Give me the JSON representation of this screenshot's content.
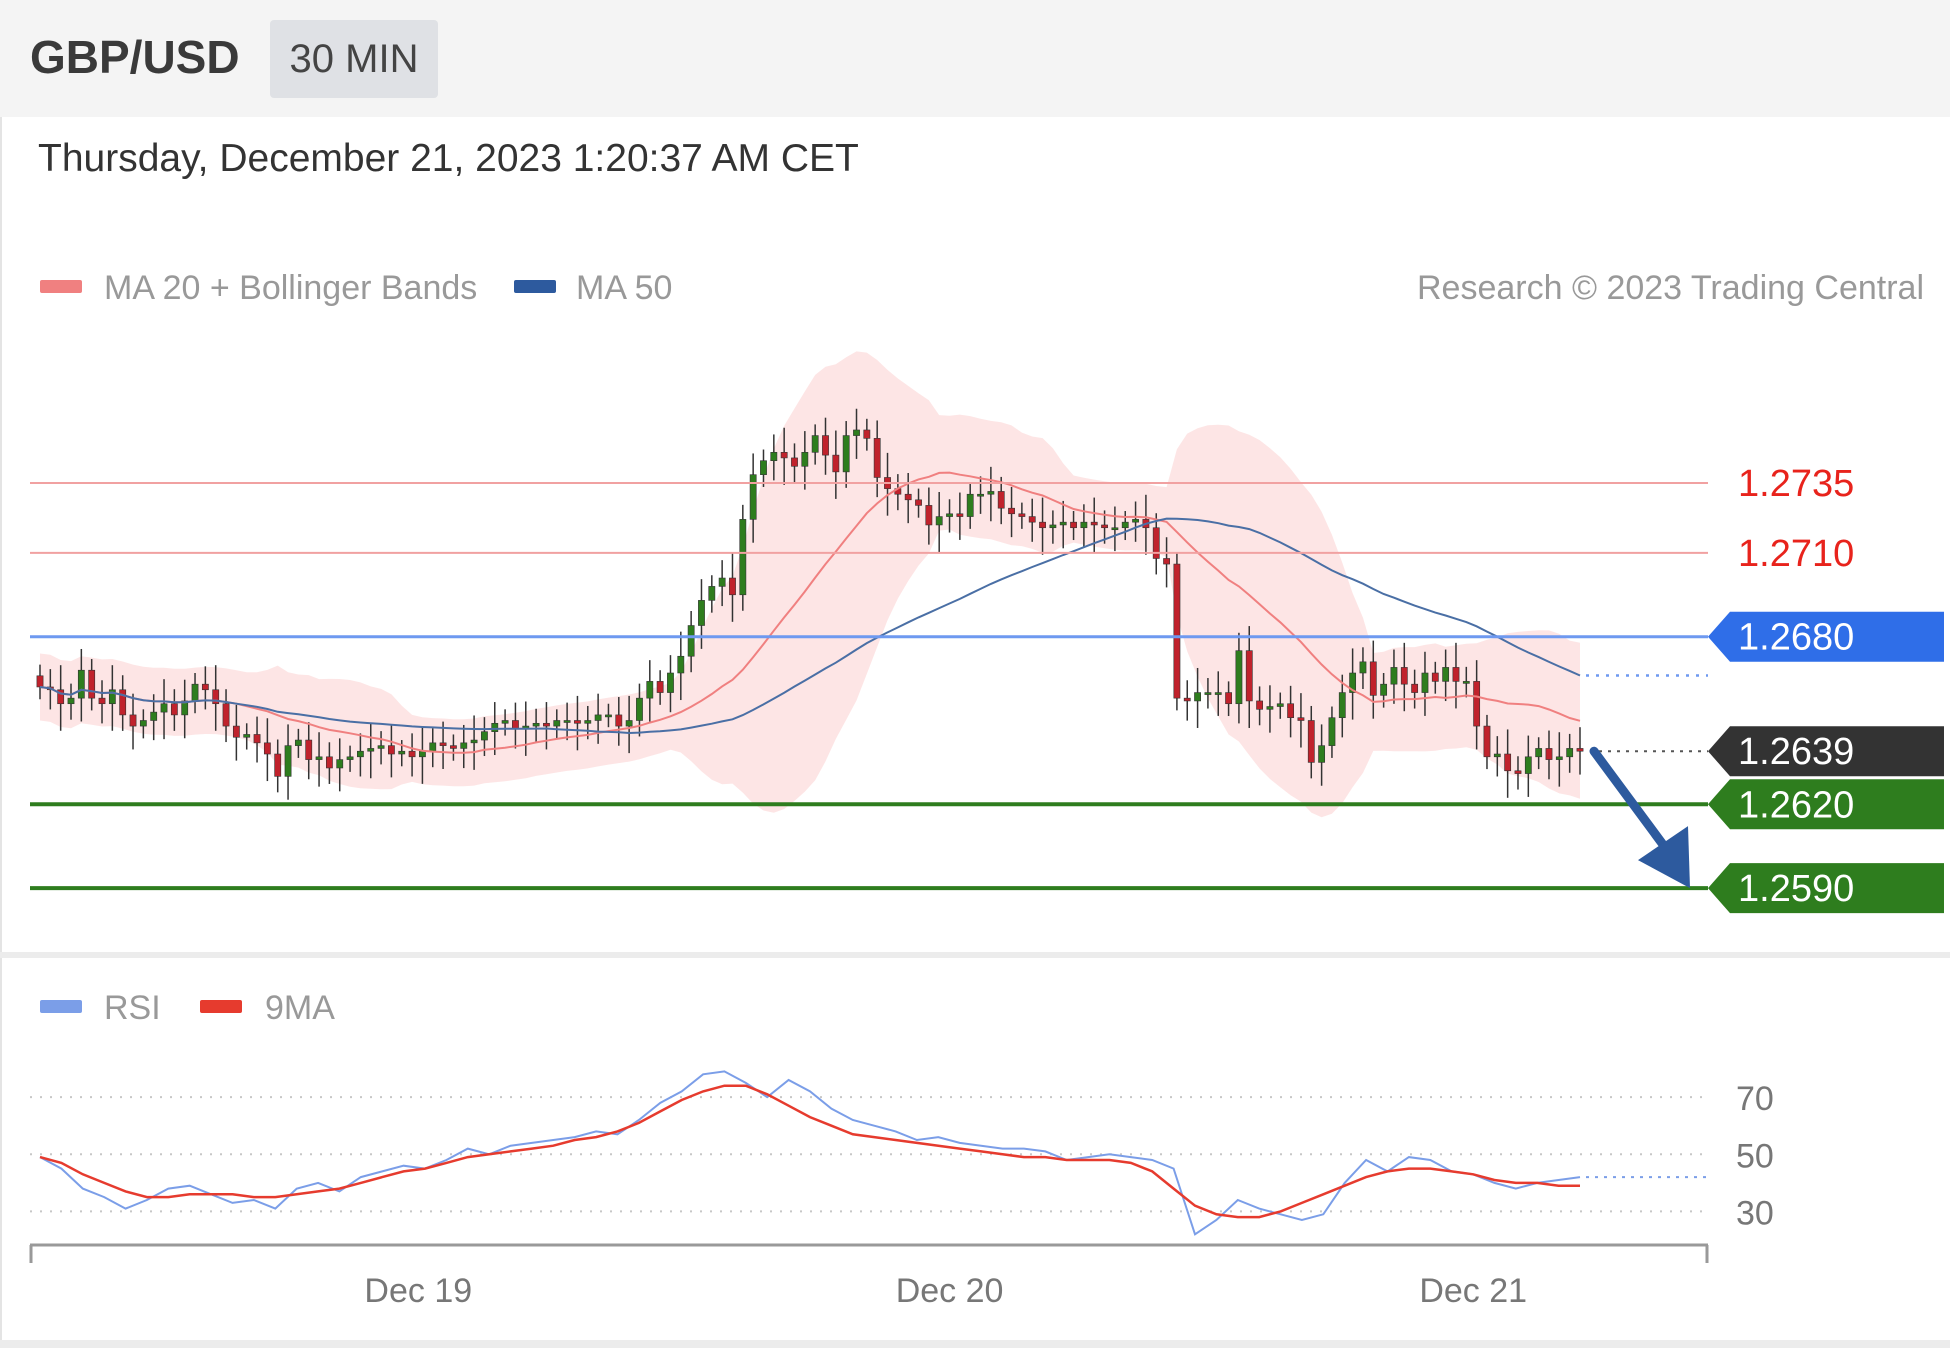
{
  "header": {
    "symbol": "GBP/USD",
    "interval": "30 MIN"
  },
  "datetime": "Thursday, December 21, 2023 1:20:37 AM CET",
  "colors": {
    "ma20": "#f08080",
    "band_fill": "#fde0e0",
    "ma50": "#4a6fa5",
    "resistance": "#e8231c",
    "pivot": "#2f6ee8",
    "current": "#333333",
    "support": "#2e7d1e",
    "arrow": "#2d5a9e",
    "rsi": "#7b9ee8",
    "rsi_ma": "#e63b2e",
    "candle_up": "#2e7d1e",
    "candle_down": "#c0222c"
  },
  "chart_data": [
    {
      "type": "candlestick",
      "ylim": [
        1.2575,
        1.2788
      ],
      "legend": [
        {
          "name": "MA 20 + Bollinger Bands",
          "color": "#f08080"
        },
        {
          "name": "MA 50",
          "color": "#2d5a9e"
        }
      ],
      "copyright": "Research © 2023 Trading Central",
      "levels": [
        {
          "value": 1.2735,
          "label": "1.2735",
          "kind": "resistance"
        },
        {
          "value": 1.271,
          "label": "1.2710",
          "kind": "resistance"
        },
        {
          "value": 1.268,
          "label": "1.2680",
          "kind": "pivot"
        },
        {
          "value": 1.2639,
          "label": "1.2639",
          "kind": "current"
        },
        {
          "value": 1.262,
          "label": "1.2620",
          "kind": "support"
        },
        {
          "value": 1.259,
          "label": "1.2590",
          "kind": "support"
        }
      ],
      "x_ticks": [
        "Dec 19",
        "Dec 20",
        "Dec 21"
      ],
      "close": [
        1.2662,
        1.2661,
        1.2656,
        1.2658,
        1.2668,
        1.2658,
        1.2656,
        1.2661,
        1.2652,
        1.2648,
        1.265,
        1.2653,
        1.2656,
        1.2652,
        1.2657,
        1.2663,
        1.2661,
        1.2656,
        1.2648,
        1.2644,
        1.2645,
        1.2642,
        1.2638,
        1.263,
        1.2641,
        1.2643,
        1.2636,
        1.2637,
        1.2633,
        1.2636,
        1.2637,
        1.2639,
        1.264,
        1.2641,
        1.2638,
        1.2639,
        1.2637,
        1.2639,
        1.2642,
        1.2641,
        1.264,
        1.2642,
        1.2643,
        1.2646,
        1.2649,
        1.265,
        1.2647,
        1.2648,
        1.2649,
        1.2648,
        1.265,
        1.265,
        1.2649,
        1.265,
        1.2652,
        1.2652,
        1.2648,
        1.265,
        1.2658,
        1.2664,
        1.266,
        1.2667,
        1.2673,
        1.2684,
        1.2693,
        1.2698,
        1.2701,
        1.2695,
        1.2722,
        1.2738,
        1.2743,
        1.2746,
        1.2744,
        1.2741,
        1.2746,
        1.2752,
        1.2745,
        1.2739,
        1.2752,
        1.2754,
        1.2751,
        1.2737,
        1.2733,
        1.2731,
        1.2729,
        1.2727,
        1.272,
        1.2723,
        1.2724,
        1.2723,
        1.2731,
        1.2731,
        1.2732,
        1.2726,
        1.2724,
        1.2723,
        1.2721,
        1.2719,
        1.272,
        1.2721,
        1.2719,
        1.2721,
        1.272,
        1.2719,
        1.2719,
        1.2721,
        1.2722,
        1.2719,
        1.2708,
        1.2706,
        1.2658,
        1.2657,
        1.266,
        1.266,
        1.266,
        1.2656,
        1.2675,
        1.2657,
        1.2654,
        1.2655,
        1.2656,
        1.2651,
        1.265,
        1.2635,
        1.2641,
        1.2651,
        1.266,
        1.2667,
        1.2671,
        1.2659,
        1.2663,
        1.2669,
        1.2663,
        1.266,
        1.2667,
        1.2664,
        1.2669,
        1.2664,
        1.2664,
        1.2648,
        1.2637,
        1.2638,
        1.2632,
        1.2631,
        1.2637,
        1.264,
        1.2636,
        1.2637,
        1.264,
        1.2639
      ]
    },
    {
      "type": "line",
      "ylim": [
        20,
        90
      ],
      "legend": [
        {
          "name": "RSI",
          "color": "#7b9ee8"
        },
        {
          "name": "9MA",
          "color": "#e63b2e"
        }
      ],
      "y_ticks": [
        70,
        50,
        30
      ],
      "series": [
        {
          "name": "RSI",
          "values": [
            49,
            45,
            38,
            35,
            31,
            34,
            38,
            39,
            36,
            33,
            34,
            31,
            38,
            40,
            37,
            42,
            44,
            46,
            45,
            48,
            52,
            50,
            53,
            54,
            55,
            56,
            58,
            57,
            62,
            68,
            72,
            78,
            79,
            75,
            70,
            76,
            72,
            66,
            62,
            60,
            58,
            55,
            56,
            54,
            53,
            52,
            52,
            51,
            48,
            49,
            50,
            49,
            48,
            45,
            22,
            27,
            34,
            31,
            29,
            27,
            29,
            40,
            48,
            44,
            49,
            48,
            44,
            43,
            40,
            38,
            40,
            41,
            42
          ]
        },
        {
          "name": "9MA",
          "values": [
            49,
            47,
            43,
            40,
            37,
            35,
            35,
            36,
            36,
            36,
            35,
            35,
            36,
            37,
            38,
            40,
            42,
            44,
            45,
            47,
            49,
            50,
            51,
            52,
            53,
            55,
            56,
            58,
            61,
            65,
            69,
            72,
            74,
            74,
            71,
            67,
            63,
            60,
            57,
            56,
            55,
            54,
            53,
            52,
            51,
            50,
            49,
            49,
            48,
            48,
            48,
            47,
            44,
            38,
            32,
            29,
            28,
            28,
            30,
            33,
            36,
            39,
            42,
            44,
            45,
            45,
            44,
            43,
            41,
            40,
            40,
            39,
            39
          ]
        }
      ]
    }
  ]
}
